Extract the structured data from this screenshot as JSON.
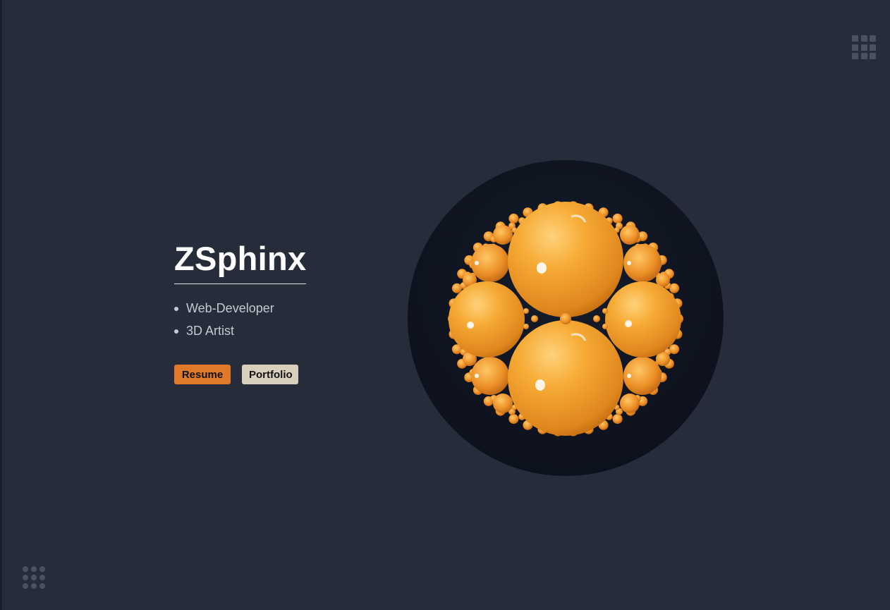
{
  "profile": {
    "name": "ZSphinx",
    "roles": [
      "Web-Developer",
      "3D Artist"
    ]
  },
  "actions": {
    "resume_label": "Resume",
    "portfolio_label": "Portfolio"
  },
  "icons": {
    "top_right": "grid-menu-icon",
    "bottom_left": "dots-menu-icon"
  },
  "colors": {
    "background": "#262c3a",
    "accent": "#e0792a",
    "secondary_button": "#d9cfbd",
    "art_backdrop": "#0e131f",
    "sphere": "#f2a12e"
  }
}
